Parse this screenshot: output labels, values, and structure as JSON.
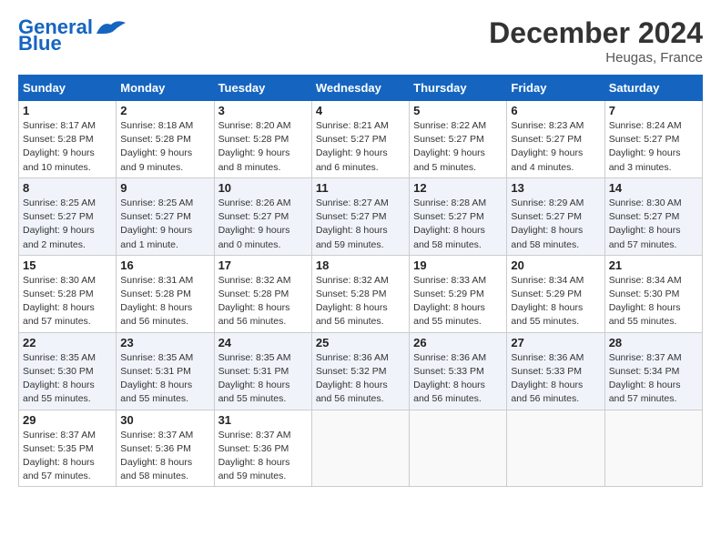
{
  "logo": {
    "line1": "General",
    "line2": "Blue"
  },
  "header": {
    "title": "December 2024",
    "location": "Heugas, France"
  },
  "weekdays": [
    "Sunday",
    "Monday",
    "Tuesday",
    "Wednesday",
    "Thursday",
    "Friday",
    "Saturday"
  ],
  "weeks": [
    [
      {
        "day": "1",
        "detail": "Sunrise: 8:17 AM\nSunset: 5:28 PM\nDaylight: 9 hours\nand 10 minutes."
      },
      {
        "day": "2",
        "detail": "Sunrise: 8:18 AM\nSunset: 5:28 PM\nDaylight: 9 hours\nand 9 minutes."
      },
      {
        "day": "3",
        "detail": "Sunrise: 8:20 AM\nSunset: 5:28 PM\nDaylight: 9 hours\nand 8 minutes."
      },
      {
        "day": "4",
        "detail": "Sunrise: 8:21 AM\nSunset: 5:27 PM\nDaylight: 9 hours\nand 6 minutes."
      },
      {
        "day": "5",
        "detail": "Sunrise: 8:22 AM\nSunset: 5:27 PM\nDaylight: 9 hours\nand 5 minutes."
      },
      {
        "day": "6",
        "detail": "Sunrise: 8:23 AM\nSunset: 5:27 PM\nDaylight: 9 hours\nand 4 minutes."
      },
      {
        "day": "7",
        "detail": "Sunrise: 8:24 AM\nSunset: 5:27 PM\nDaylight: 9 hours\nand 3 minutes."
      }
    ],
    [
      {
        "day": "8",
        "detail": "Sunrise: 8:25 AM\nSunset: 5:27 PM\nDaylight: 9 hours\nand 2 minutes."
      },
      {
        "day": "9",
        "detail": "Sunrise: 8:25 AM\nSunset: 5:27 PM\nDaylight: 9 hours\nand 1 minute."
      },
      {
        "day": "10",
        "detail": "Sunrise: 8:26 AM\nSunset: 5:27 PM\nDaylight: 9 hours\nand 0 minutes."
      },
      {
        "day": "11",
        "detail": "Sunrise: 8:27 AM\nSunset: 5:27 PM\nDaylight: 8 hours\nand 59 minutes."
      },
      {
        "day": "12",
        "detail": "Sunrise: 8:28 AM\nSunset: 5:27 PM\nDaylight: 8 hours\nand 58 minutes."
      },
      {
        "day": "13",
        "detail": "Sunrise: 8:29 AM\nSunset: 5:27 PM\nDaylight: 8 hours\nand 58 minutes."
      },
      {
        "day": "14",
        "detail": "Sunrise: 8:30 AM\nSunset: 5:27 PM\nDaylight: 8 hours\nand 57 minutes."
      }
    ],
    [
      {
        "day": "15",
        "detail": "Sunrise: 8:30 AM\nSunset: 5:28 PM\nDaylight: 8 hours\nand 57 minutes."
      },
      {
        "day": "16",
        "detail": "Sunrise: 8:31 AM\nSunset: 5:28 PM\nDaylight: 8 hours\nand 56 minutes."
      },
      {
        "day": "17",
        "detail": "Sunrise: 8:32 AM\nSunset: 5:28 PM\nDaylight: 8 hours\nand 56 minutes."
      },
      {
        "day": "18",
        "detail": "Sunrise: 8:32 AM\nSunset: 5:28 PM\nDaylight: 8 hours\nand 56 minutes."
      },
      {
        "day": "19",
        "detail": "Sunrise: 8:33 AM\nSunset: 5:29 PM\nDaylight: 8 hours\nand 55 minutes."
      },
      {
        "day": "20",
        "detail": "Sunrise: 8:34 AM\nSunset: 5:29 PM\nDaylight: 8 hours\nand 55 minutes."
      },
      {
        "day": "21",
        "detail": "Sunrise: 8:34 AM\nSunset: 5:30 PM\nDaylight: 8 hours\nand 55 minutes."
      }
    ],
    [
      {
        "day": "22",
        "detail": "Sunrise: 8:35 AM\nSunset: 5:30 PM\nDaylight: 8 hours\nand 55 minutes."
      },
      {
        "day": "23",
        "detail": "Sunrise: 8:35 AM\nSunset: 5:31 PM\nDaylight: 8 hours\nand 55 minutes."
      },
      {
        "day": "24",
        "detail": "Sunrise: 8:35 AM\nSunset: 5:31 PM\nDaylight: 8 hours\nand 55 minutes."
      },
      {
        "day": "25",
        "detail": "Sunrise: 8:36 AM\nSunset: 5:32 PM\nDaylight: 8 hours\nand 56 minutes."
      },
      {
        "day": "26",
        "detail": "Sunrise: 8:36 AM\nSunset: 5:33 PM\nDaylight: 8 hours\nand 56 minutes."
      },
      {
        "day": "27",
        "detail": "Sunrise: 8:36 AM\nSunset: 5:33 PM\nDaylight: 8 hours\nand 56 minutes."
      },
      {
        "day": "28",
        "detail": "Sunrise: 8:37 AM\nSunset: 5:34 PM\nDaylight: 8 hours\nand 57 minutes."
      }
    ],
    [
      {
        "day": "29",
        "detail": "Sunrise: 8:37 AM\nSunset: 5:35 PM\nDaylight: 8 hours\nand 57 minutes."
      },
      {
        "day": "30",
        "detail": "Sunrise: 8:37 AM\nSunset: 5:36 PM\nDaylight: 8 hours\nand 58 minutes."
      },
      {
        "day": "31",
        "detail": "Sunrise: 8:37 AM\nSunset: 5:36 PM\nDaylight: 8 hours\nand 59 minutes."
      },
      null,
      null,
      null,
      null
    ]
  ]
}
